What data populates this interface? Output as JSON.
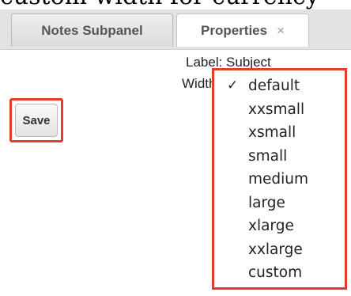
{
  "top_text": "custom width for currency",
  "tabs": [
    {
      "label": "Notes Subpanel",
      "active": false
    },
    {
      "label": "Properties",
      "active": true,
      "close_icon": "×"
    }
  ],
  "properties": {
    "label_text": "Label: Subject",
    "width_label": "Width"
  },
  "save_label": "Save",
  "width_dropdown": {
    "selected": "default",
    "check_mark": "✓",
    "options": [
      "default",
      "xxsmall",
      "xsmall",
      "small",
      "medium",
      "large",
      "xlarge",
      "xxlarge",
      "custom"
    ]
  },
  "colors": {
    "highlight": "#e23c2b",
    "tabbar_bg": "#e3e3e3"
  }
}
